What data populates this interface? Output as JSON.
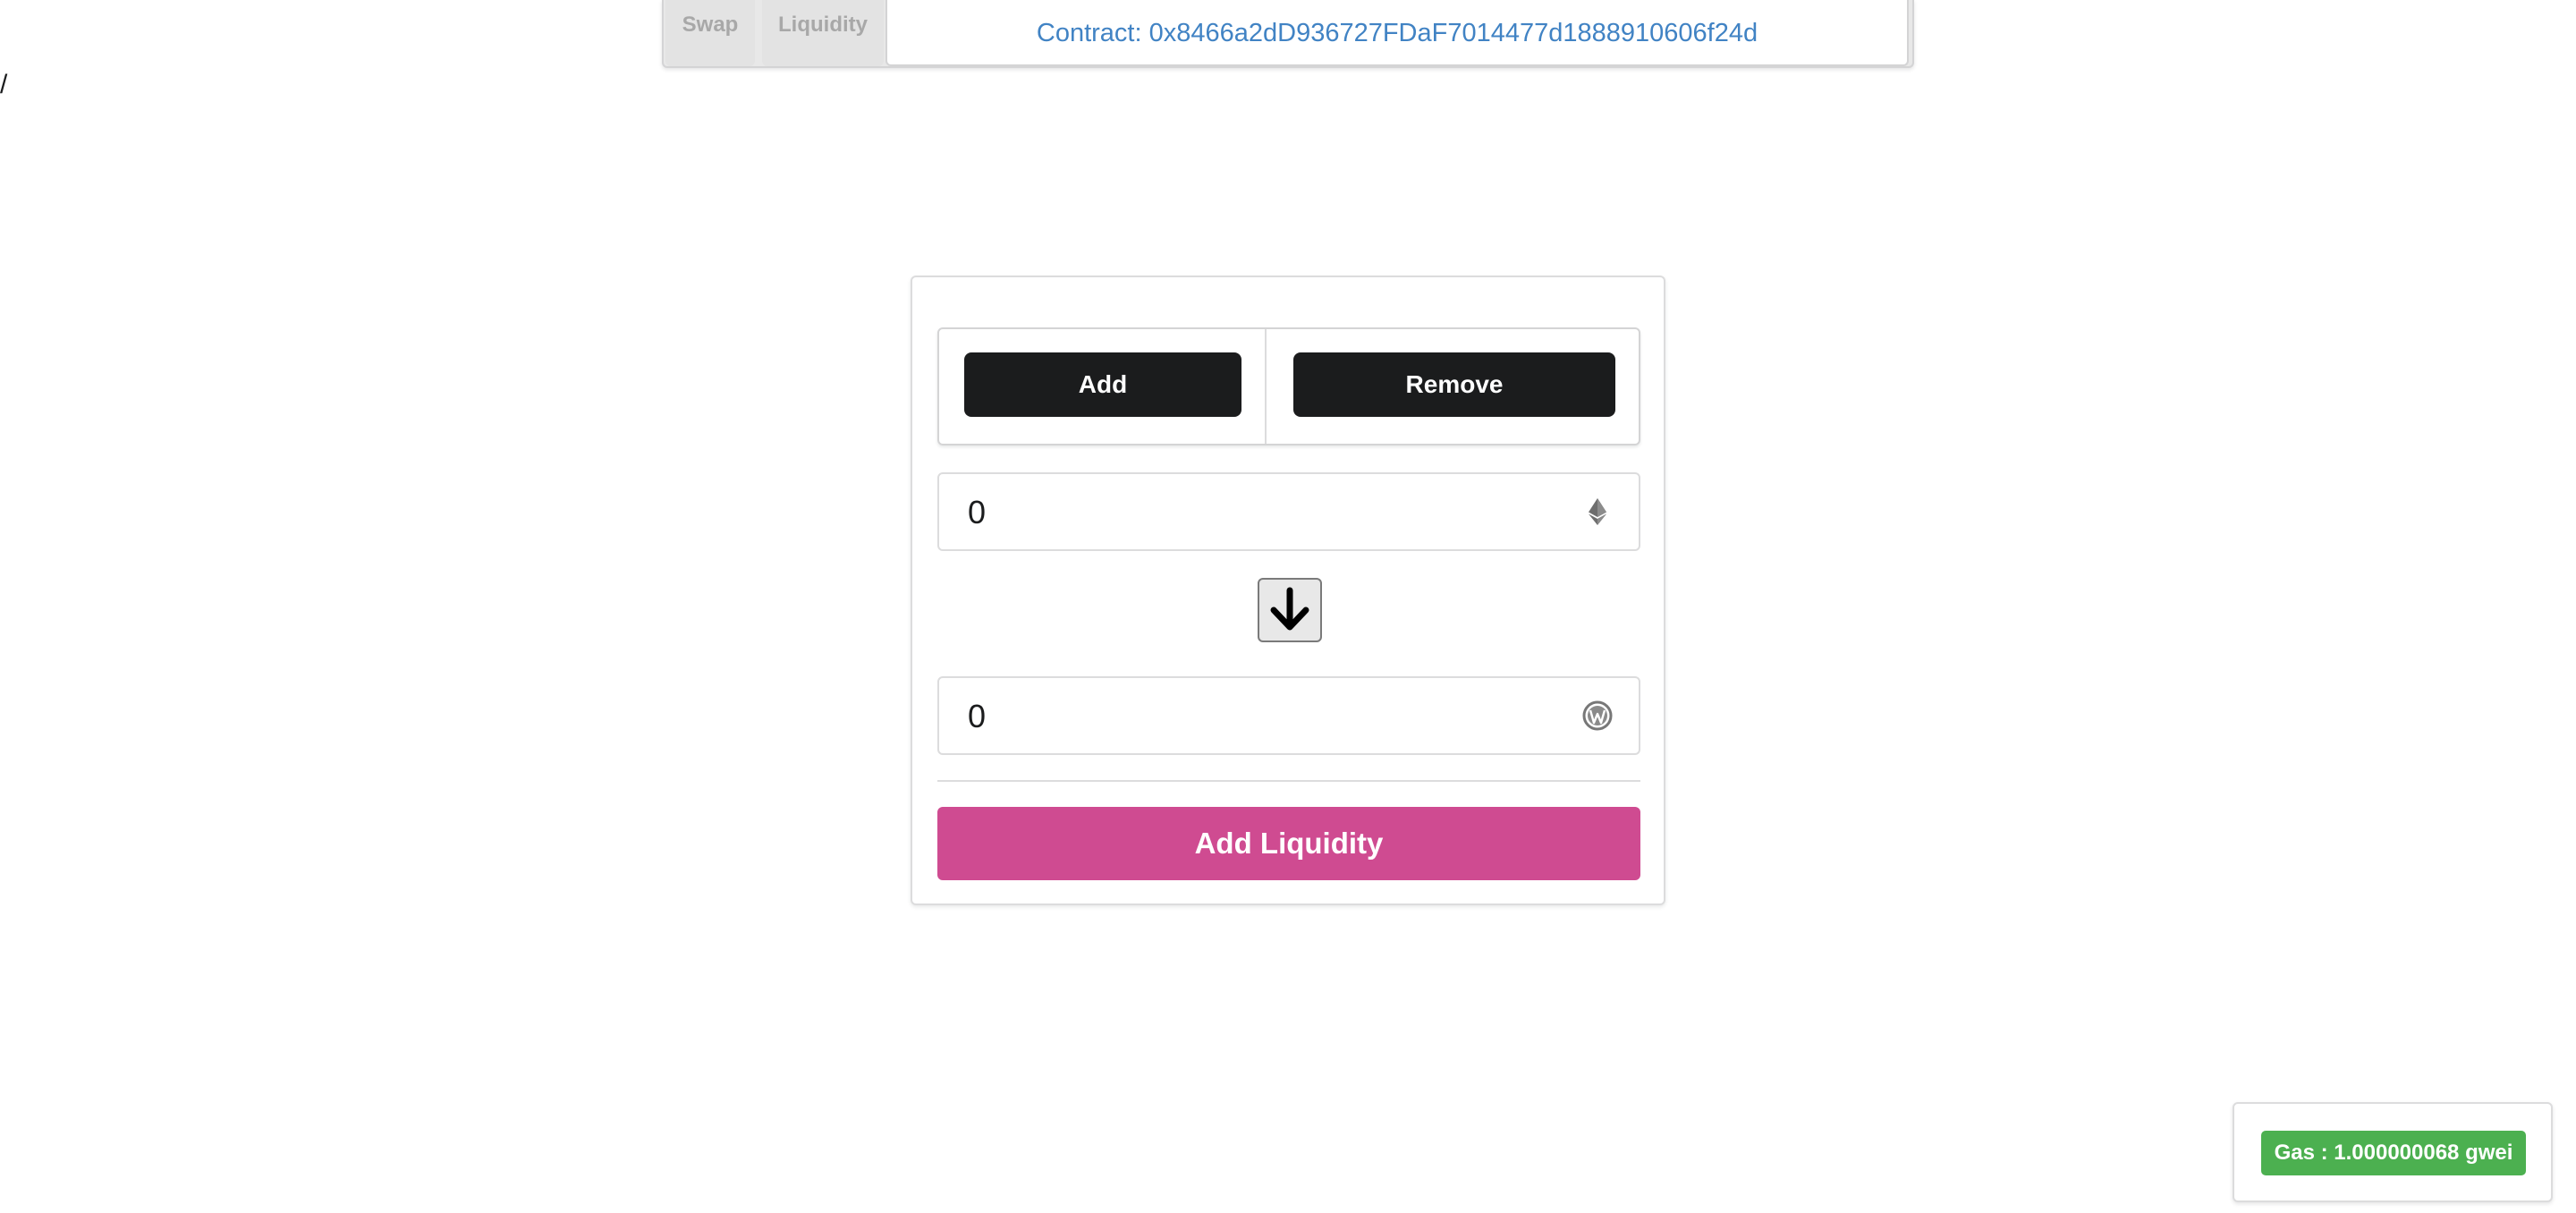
{
  "nav": {
    "tabs": [
      {
        "label": "Swap"
      },
      {
        "label": "Liquidity"
      }
    ],
    "contract_label": "Contract: 0x8466a2dD936727FDaF7014477d1888910606f24d"
  },
  "breadcrumb_slash": "/",
  "liquidity": {
    "mode_buttons": {
      "add_label": "Add",
      "remove_label": "Remove"
    },
    "eth_amount": "0",
    "token_amount": "0",
    "eth_icon": "ethereum-icon",
    "token_icon": "wordpress-icon",
    "switch_icon": "arrow-down-icon",
    "submit_label": "Add Liquidity",
    "submit_color": "#cf4b91"
  },
  "gas": {
    "label": "Gas : 1.000000068 gwei",
    "color": "#4cb050"
  }
}
